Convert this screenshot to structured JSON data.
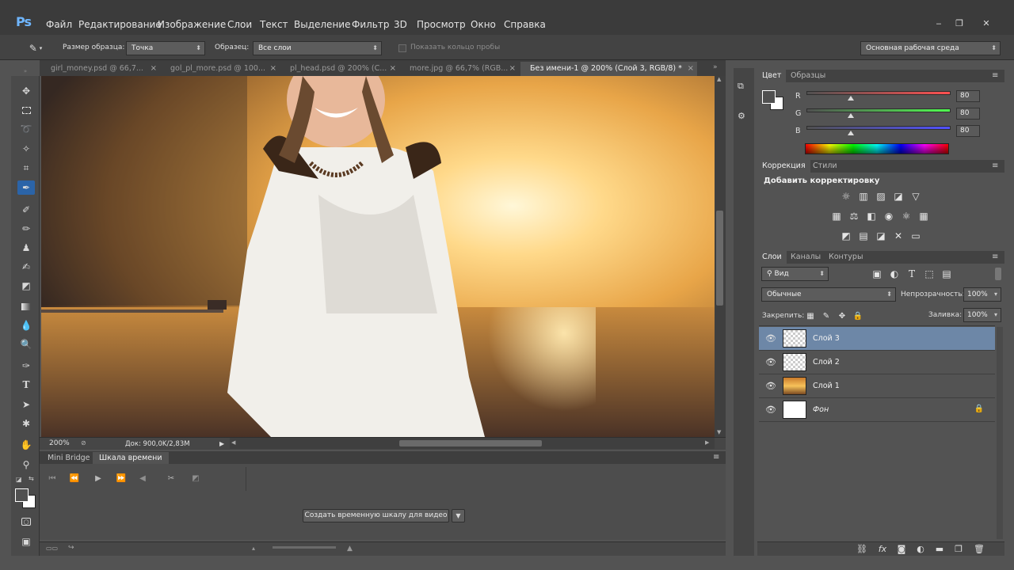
{
  "app": {
    "logo": "Ps"
  },
  "menu": [
    "Файл",
    "Редактирование",
    "Изображение",
    "Слои",
    "Текст",
    "Выделение",
    "Фильтр",
    "3D",
    "Просмотр",
    "Окно",
    "Справка"
  ],
  "window_controls": {
    "minimize": "‒",
    "restore": "❐",
    "close": "✕"
  },
  "options": {
    "sample_size_label": "Размер образца:",
    "sample_size_value": "Точка",
    "sample_label": "Образец:",
    "sample_value": "Все слои",
    "show_ring_label": "Показать кольцо пробы",
    "workspace": "Основная рабочая среда"
  },
  "doc_tabs": [
    "girl_money.psd @ 66,7...",
    "gol_pl_more.psd @ 100...",
    "pl_head.psd @ 200% (C...",
    "more.jpg @ 66,7% (RGB...",
    "Без имени-1 @ 200% (Слой 3, RGB/8) *"
  ],
  "status": {
    "zoom": "200%",
    "doc": "Док: 900,0K/2,83M"
  },
  "timeline": {
    "tabs": [
      "Mini Bridge",
      "Шкала времени"
    ],
    "create_button": "Создать временную шкалу для видео"
  },
  "color_panel": {
    "tabs": [
      "Цвет",
      "Образцы"
    ],
    "channels": [
      {
        "label": "R",
        "value": "80",
        "knob": 0.31
      },
      {
        "label": "G",
        "value": "80",
        "knob": 0.31
      },
      {
        "label": "B",
        "value": "80",
        "knob": 0.31
      }
    ]
  },
  "adjust_panel": {
    "tabs": [
      "Коррекция",
      "Стили"
    ],
    "title": "Добавить корректировку"
  },
  "layers_panel": {
    "tabs": [
      "Слои",
      "Каналы",
      "Контуры"
    ],
    "filter_value": "Вид",
    "blend_mode": "Обычные",
    "opacity_label": "Непрозрачность:",
    "opacity_value": "100%",
    "lock_label": "Закрепить:",
    "fill_label": "Заливка:",
    "fill_value": "100%",
    "layers": [
      {
        "name": "Слой 3",
        "selected": true
      },
      {
        "name": "Слой 2",
        "selected": false
      },
      {
        "name": "Слой 1",
        "selected": false
      },
      {
        "name": "Фон",
        "selected": false
      }
    ]
  },
  "colors": {
    "accent": "#2b64a8",
    "selected_layer": "#6d87a7"
  }
}
